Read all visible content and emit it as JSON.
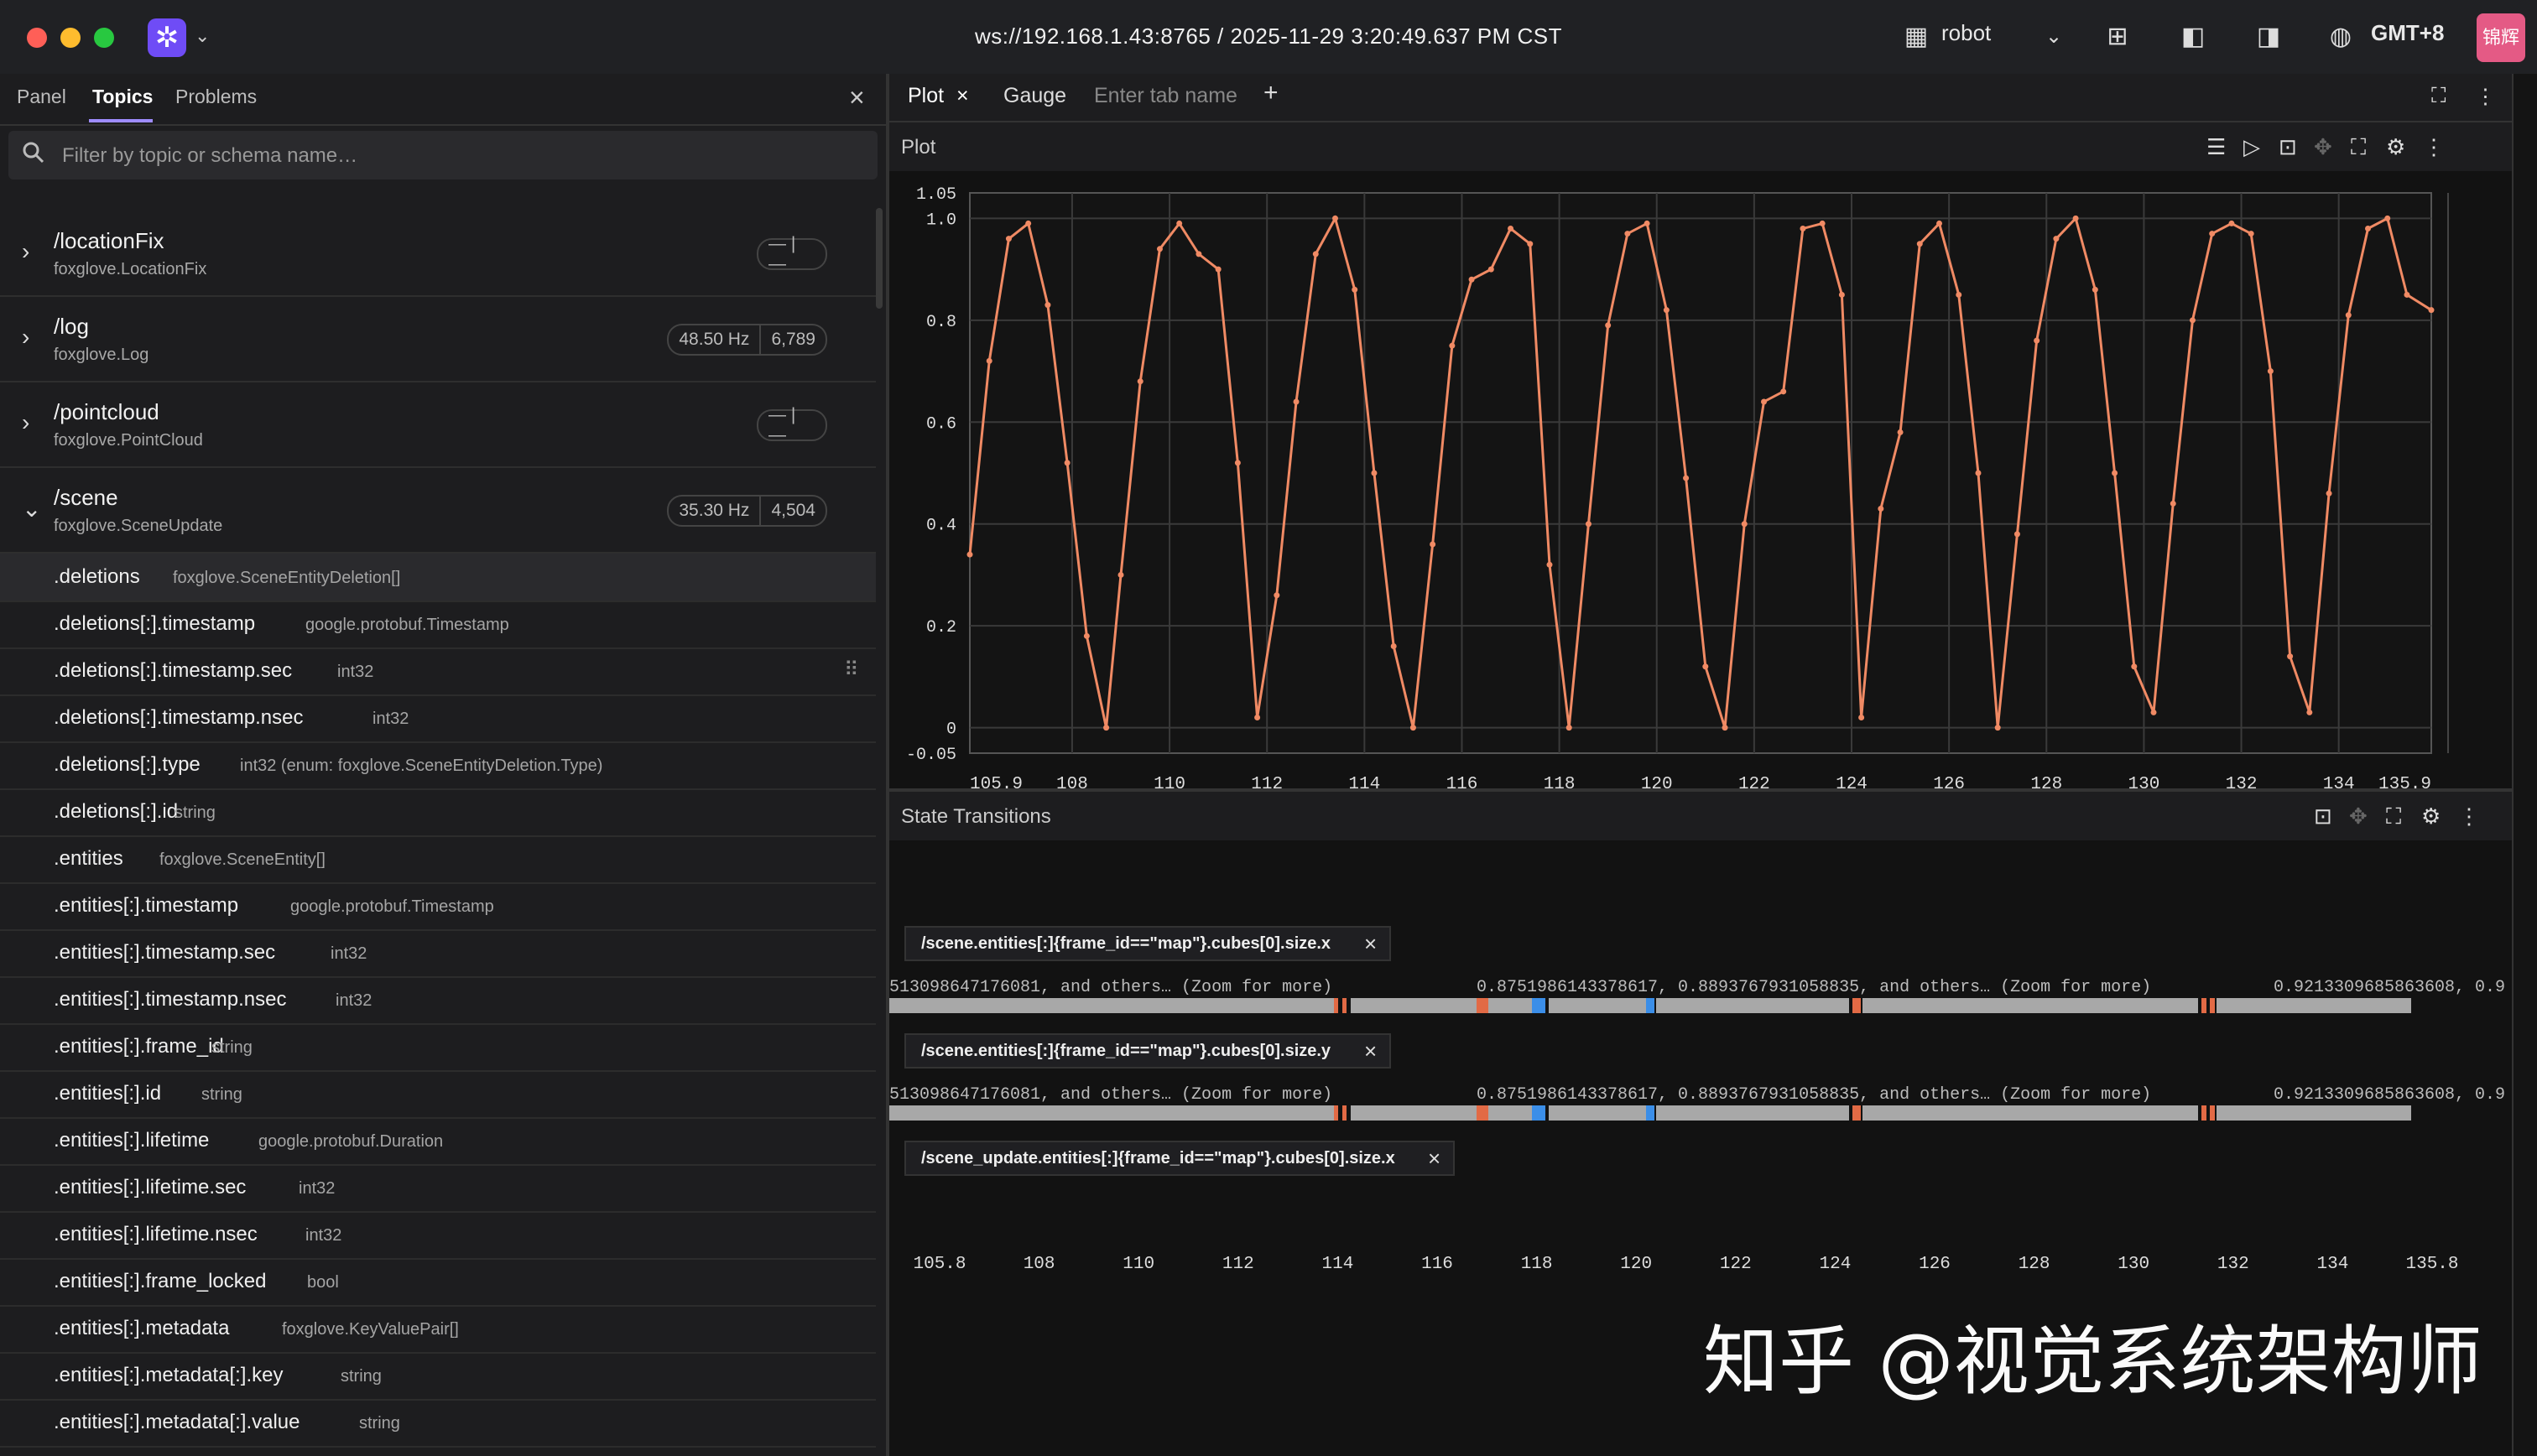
{
  "window": {
    "url_title": "ws://192.168.1.43:8765 / 2025-11-29 3:20:49.637 PM CST",
    "layout_name": "robot",
    "timezone": "GMT+8",
    "avatar_text": "锦辉",
    "accent": "#6f4cf6"
  },
  "left_panel": {
    "tabs": [
      "Panel",
      "Topics",
      "Problems"
    ],
    "active_tab": "Topics",
    "search_placeholder": "Filter by topic or schema name…",
    "topics": [
      {
        "name": "/locationFix",
        "schema": "foxglove.LocationFix",
        "hz": "",
        "count": "",
        "expanded": false
      },
      {
        "name": "/log",
        "schema": "foxglove.Log",
        "hz": "48.50 Hz",
        "count": "6,789",
        "expanded": false
      },
      {
        "name": "/pointcloud",
        "schema": "foxglove.PointCloud",
        "hz": "",
        "count": "",
        "expanded": false
      },
      {
        "name": "/scene",
        "schema": "foxglove.SceneUpdate",
        "hz": "35.30 Hz",
        "count": "4,504",
        "expanded": true
      }
    ],
    "fields": [
      {
        "path": ".deletions",
        "type": "foxglove.SceneEntityDeletion[]"
      },
      {
        "path": ".deletions[:].timestamp",
        "type": "google.protobuf.Timestamp"
      },
      {
        "path": ".deletions[:].timestamp.sec",
        "type": "int32"
      },
      {
        "path": ".deletions[:].timestamp.nsec",
        "type": "int32"
      },
      {
        "path": ".deletions[:].type",
        "type": "int32 (enum: foxglove.SceneEntityDeletion.Type)"
      },
      {
        "path": ".deletions[:].id",
        "type": "string"
      },
      {
        "path": ".entities",
        "type": "foxglove.SceneEntity[]"
      },
      {
        "path": ".entities[:].timestamp",
        "type": "google.protobuf.Timestamp"
      },
      {
        "path": ".entities[:].timestamp.sec",
        "type": "int32"
      },
      {
        "path": ".entities[:].timestamp.nsec",
        "type": "int32"
      },
      {
        "path": ".entities[:].frame_id",
        "type": "string"
      },
      {
        "path": ".entities[:].id",
        "type": "string"
      },
      {
        "path": ".entities[:].lifetime",
        "type": "google.protobuf.Duration"
      },
      {
        "path": ".entities[:].lifetime.sec",
        "type": "int32"
      },
      {
        "path": ".entities[:].lifetime.nsec",
        "type": "int32"
      },
      {
        "path": ".entities[:].frame_locked",
        "type": "bool"
      },
      {
        "path": ".entities[:].metadata",
        "type": "foxglove.KeyValuePair[]"
      },
      {
        "path": ".entities[:].metadata[:].key",
        "type": "string"
      },
      {
        "path": ".entities[:].metadata[:].value",
        "type": "string"
      }
    ]
  },
  "right_panel": {
    "tabs": [
      "Plot",
      "Gauge"
    ],
    "new_tab_placeholder": "Enter tab name",
    "plot_title": "Plot",
    "state_title": "State Transitions",
    "series_color": "#f08a64",
    "state_rows": [
      {
        "path": "/scene.entities[:]{frame_id==\"map\"}.cubes[0].size.x",
        "labels": [
          "513098647176081, and others… (Zoom for more)",
          "0.8751986143378617, 0.8893767931058835, and others… (Zoom for more)",
          "0.9213309685863608, 0.9"
        ]
      },
      {
        "path": "/scene.entities[:]{frame_id==\"map\"}.cubes[0].size.y",
        "labels": [
          "513098647176081, and others… (Zoom for more)",
          "0.8751986143378617, 0.8893767931058835, and others… (Zoom for more)",
          "0.9213309685863608, 0.9"
        ]
      },
      {
        "path": "/scene_update.entities[:]{frame_id==\"map\"}.cubes[0].size.x",
        "labels": []
      }
    ],
    "state_x_ticks": [
      "105.8",
      "108",
      "110",
      "112",
      "114",
      "116",
      "118",
      "120",
      "122",
      "124",
      "126",
      "128",
      "130",
      "132",
      "134",
      "135.8"
    ]
  },
  "chart_data": {
    "type": "line",
    "title": "",
    "xlabel": "",
    "ylabel": "",
    "xlim": [
      105.9,
      135.9
    ],
    "ylim": [
      -0.05,
      1.05
    ],
    "x_ticks": [
      "105.9",
      "108",
      "110",
      "112",
      "114",
      "116",
      "118",
      "120",
      "122",
      "124",
      "126",
      "128",
      "130",
      "132",
      "134",
      "135.9"
    ],
    "y_ticks": [
      "1.05",
      "1.0",
      "0.8",
      "0.6",
      "0.4",
      "0.2",
      "0",
      "-0.05"
    ],
    "grid": true,
    "series": [
      {
        "color": "#f08a64",
        "x": [
          105.9,
          106.3,
          106.7,
          107.1,
          107.5,
          107.9,
          108.3,
          108.7,
          109.0,
          109.4,
          109.8,
          110.2,
          110.6,
          111.0,
          111.4,
          111.8,
          112.2,
          112.6,
          113.0,
          113.4,
          113.8,
          114.2,
          114.6,
          115.0,
          115.4,
          115.8,
          116.2,
          116.6,
          117.0,
          117.4,
          117.8,
          118.2,
          118.6,
          119.0,
          119.4,
          119.8,
          120.2,
          120.6,
          121.0,
          121.4,
          121.8,
          122.2,
          122.6,
          123.0,
          123.4,
          123.8,
          124.2,
          124.6,
          125.0,
          125.4,
          125.8,
          126.2,
          126.6,
          127.0,
          127.4,
          127.8,
          128.2,
          128.6,
          129.0,
          129.4,
          129.8,
          130.2,
          130.6,
          131.0,
          131.4,
          131.8,
          132.2,
          132.6,
          133.0,
          133.4,
          133.8,
          134.2,
          134.6,
          135.0,
          135.4,
          135.9
        ],
        "y": [
          0.34,
          0.72,
          0.96,
          0.99,
          0.83,
          0.52,
          0.18,
          0.0,
          0.3,
          0.68,
          0.94,
          0.99,
          0.93,
          0.9,
          0.52,
          0.02,
          0.26,
          0.64,
          0.93,
          1.0,
          0.86,
          0.5,
          0.16,
          0.0,
          0.36,
          0.75,
          0.88,
          0.9,
          0.98,
          0.95,
          0.32,
          0.0,
          0.4,
          0.79,
          0.97,
          0.99,
          0.82,
          0.49,
          0.12,
          0.0,
          0.4,
          0.64,
          0.66,
          0.98,
          0.99,
          0.85,
          0.02,
          0.43,
          0.58,
          0.95,
          0.99,
          0.85,
          0.5,
          0.0,
          0.38,
          0.76,
          0.96,
          1.0,
          0.86,
          0.5,
          0.12,
          0.03,
          0.44,
          0.8,
          0.97,
          0.99,
          0.97,
          0.7,
          0.14,
          0.03,
          0.46,
          0.81,
          0.98,
          1.0,
          0.85,
          0.82
        ]
      }
    ]
  },
  "watermark": "知乎 @视觉系统架构师"
}
